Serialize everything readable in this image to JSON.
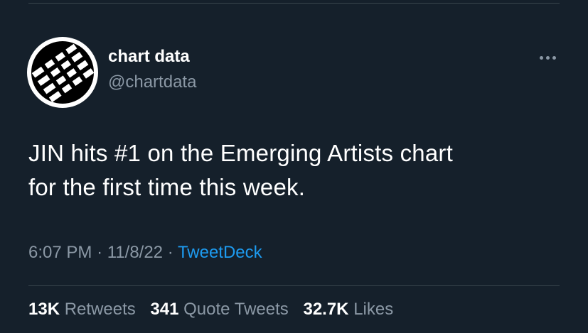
{
  "tweet": {
    "author_name": "chart data",
    "author_handle": "@chartdata",
    "text_line1": "JIN hits #1 on the Emerging Artists chart",
    "text_line2": "for the first time this week.",
    "time": "6:07 PM",
    "separator": "·",
    "date": "11/8/22",
    "source": "TweetDeck"
  },
  "stats": {
    "retweets_count": "13K",
    "retweets_label": "Retweets",
    "quotes_count": "341",
    "quotes_label": "Quote Tweets",
    "likes_count": "32.7K",
    "likes_label": "Likes"
  },
  "icons": {
    "more": "more-horizontal-icon",
    "avatar_logo": "piano-keys-logo"
  },
  "colors": {
    "background": "#15202b",
    "text": "#ffffff",
    "secondary_text": "#8b98a5",
    "link": "#1d9bf0",
    "divider": "#38444d"
  }
}
